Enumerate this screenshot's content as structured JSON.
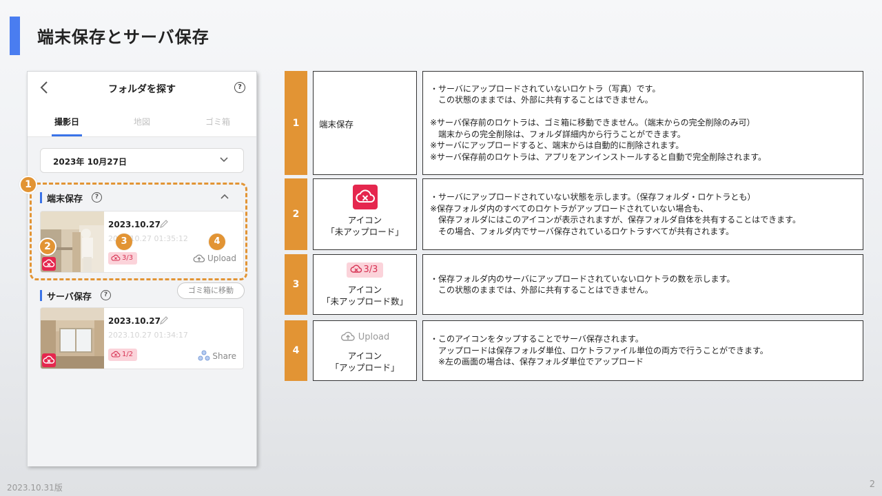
{
  "slide": {
    "title": "端末保存とサーバ保存",
    "version": "2023.10.31版",
    "page_number": "2",
    "accent_color": "#4a7df0",
    "orange_color": "#e29434"
  },
  "phone": {
    "header_title": "フォルダを探す",
    "help_glyph": "?",
    "tabs": [
      {
        "label": "撮影日",
        "active": true
      },
      {
        "label": "地図",
        "active": false
      },
      {
        "label": "ゴミ箱",
        "active": false
      }
    ],
    "date_selector": "2023年 10月27日",
    "local_section": {
      "title": "端末保存",
      "card": {
        "date": "2023.10.27",
        "time": "2023.10.27 01:35:12",
        "count": "3/3",
        "action": "Upload"
      }
    },
    "trash_button": "ゴミ箱に移動",
    "server_section": {
      "title": "サーバ保存",
      "card": {
        "date": "2023.10.27",
        "time": "2023.10.27 01:34:17",
        "count": "1/2",
        "action": "Share"
      }
    },
    "callouts": [
      "1",
      "2",
      "3",
      "4"
    ]
  },
  "table": {
    "rows": [
      {
        "num": "1",
        "item": "端末保存",
        "desc": [
          "・サーバにアップロードされていないロケトラ（写真）です。",
          "　この状態のままでは、外部に共有することはできません。",
          "",
          "※サーバ保存前のロケトラは、ゴミ箱に移動できません。（端末からの完全削除のみ可）",
          "　端末からの完全削除は、フォルダ詳細内から行うことができます。",
          "※サーバにアップロードすると、端末からは自動的に削除されます。",
          "※サーバ保存前のロケトラは、アプリをアンインストールすると自動で完全削除されます。"
        ]
      },
      {
        "num": "2",
        "item_lines": [
          "アイコン",
          "「未アップロード」"
        ],
        "icon": "cloud-x-icon",
        "desc": [
          "・サーバにアップロードされていない状態を示します。（保存フォルダ・ロケトラとも）",
          "※保存フォルダ内のすべてのロケトラがアップロードされていない場合も、",
          "　保存フォルダにはこのアイコンが表示されますが、保存フォルダ自体を共有することはできます。",
          "　その場合、フォルダ内でサーバ保存されているロケトラすべてが共有されます。"
        ]
      },
      {
        "num": "3",
        "item_badge": "3/3",
        "item_lines": [
          "アイコン",
          "「未アップロード数」"
        ],
        "desc": [
          "・保存フォルダ内のサーバにアップロードされていないロケトラの数を示します。",
          "　この状態のままでは、外部に共有することはできません。"
        ]
      },
      {
        "num": "4",
        "item_upload": "Upload",
        "item_lines": [
          "アイコン",
          "「アップロード」"
        ],
        "desc": [
          "・このアイコンをタップすることでサーバ保存されます。",
          "　アップロードは保存フォルダ単位、ロケトラファイル単位の両方で行うことができます。",
          "　※左の画面の場合は、保存フォルダ単位でアップロード"
        ]
      }
    ]
  }
}
